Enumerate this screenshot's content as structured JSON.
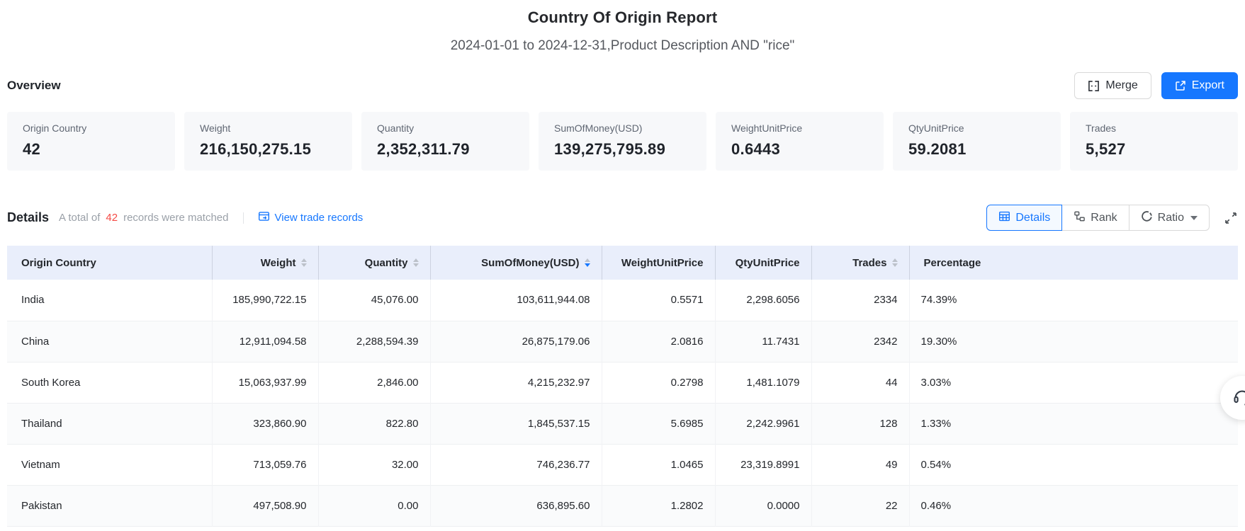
{
  "page": {
    "title": "Country Of Origin Report",
    "subtitle": "2024-01-01 to 2024-12-31,Product Description AND \"rice\""
  },
  "colors": {
    "accent": "#1677ff",
    "table_header_bg": "#e9eefb",
    "count_red": "#f54a45",
    "card_bg": "#f7f8fa"
  },
  "overview": {
    "label": "Overview",
    "merge_label": "Merge",
    "export_label": "Export",
    "cards": [
      {
        "label": "Origin Country",
        "value": "42"
      },
      {
        "label": "Weight",
        "value": "216,150,275.15"
      },
      {
        "label": "Quantity",
        "value": "2,352,311.79"
      },
      {
        "label": "SumOfMoney(USD)",
        "value": "139,275,795.89"
      },
      {
        "label": "WeightUnitPrice",
        "value": "0.6443"
      },
      {
        "label": "QtyUnitPrice",
        "value": "59.2081"
      },
      {
        "label": "Trades",
        "value": "5,527"
      }
    ]
  },
  "details": {
    "label": "Details",
    "total_prefix": "A total of",
    "total_count": "42",
    "total_suffix": "records were matched",
    "view_link": "View trade records",
    "toggles": [
      {
        "label": "Details",
        "icon": "table-icon",
        "active": true
      },
      {
        "label": "Rank",
        "icon": "rank-icon",
        "active": false
      },
      {
        "label": "Ratio",
        "icon": "ratio-icon",
        "active": false,
        "dropdown": true
      }
    ]
  },
  "table": {
    "columns": [
      {
        "label": "Origin Country",
        "align": "left",
        "sortable": false
      },
      {
        "label": "Weight",
        "align": "right",
        "sortable": true
      },
      {
        "label": "Quantity",
        "align": "right",
        "sortable": true
      },
      {
        "label": "SumOfMoney(USD)",
        "align": "right",
        "sortable": true,
        "sort": "desc"
      },
      {
        "label": "WeightUnitPrice",
        "align": "right",
        "sortable": false
      },
      {
        "label": "QtyUnitPrice",
        "align": "right",
        "sortable": false
      },
      {
        "label": "Trades",
        "align": "right",
        "sortable": true
      },
      {
        "label": "Percentage",
        "align": "left",
        "sortable": false
      }
    ],
    "rows": [
      [
        "India",
        "185,990,722.15",
        "45,076.00",
        "103,611,944.08",
        "0.5571",
        "2,298.6056",
        "2334",
        "74.39%"
      ],
      [
        "China",
        "12,911,094.58",
        "2,288,594.39",
        "26,875,179.06",
        "2.0816",
        "11.7431",
        "2342",
        "19.30%"
      ],
      [
        "South Korea",
        "15,063,937.99",
        "2,846.00",
        "4,215,232.97",
        "0.2798",
        "1,481.1079",
        "44",
        "3.03%"
      ],
      [
        "Thailand",
        "323,860.90",
        "822.80",
        "1,845,537.15",
        "5.6985",
        "2,242.9961",
        "128",
        "1.33%"
      ],
      [
        "Vietnam",
        "713,059.76",
        "32.00",
        "746,236.77",
        "1.0465",
        "23,319.8991",
        "49",
        "0.54%"
      ],
      [
        "Pakistan",
        "497,508.90",
        "0.00",
        "636,895.60",
        "1.2802",
        "0.0000",
        "22",
        "0.46%"
      ]
    ]
  }
}
